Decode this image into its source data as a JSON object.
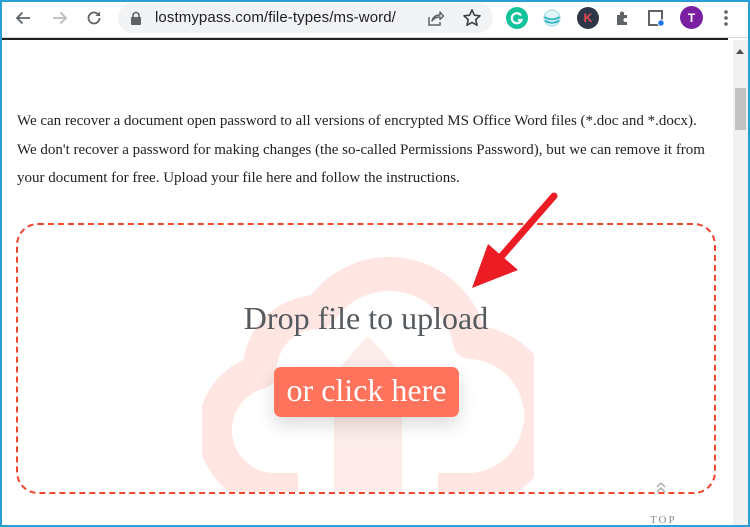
{
  "browser": {
    "url": "lostmypass.com/file-types/ms-word/",
    "nav": {
      "back_icon": "arrow-left-icon",
      "forward_icon": "arrow-right-icon",
      "reload_icon": "reload-icon"
    },
    "omnibox_icons": [
      "lock-icon",
      "share-icon",
      "star-icon"
    ],
    "extensions": [
      {
        "name": "grammarly",
        "letter": "G",
        "color": "#15c39a"
      },
      {
        "name": "globe-extension",
        "letter": "",
        "color": "#4fc1d6"
      },
      {
        "name": "k-extension",
        "letter": "K",
        "color": "#2d3748"
      },
      {
        "name": "extensions-puzzle",
        "letter": "",
        "color": "#5f6368"
      },
      {
        "name": "reading-mode",
        "letter": "",
        "color": "#1a73e8"
      }
    ],
    "profile": {
      "letter": "T",
      "color": "#7b1fa2"
    },
    "menu_icon": "kebab-menu-icon"
  },
  "page": {
    "intro_lines": [
      "We can recover a document open password to all versions of encrypted MS Office Word files (*.doc and *.docx).",
      "We don't recover a password for making changes (the so-called Permissions Password), but we can remove it from",
      "your document for free. Upload your file here and follow the instructions."
    ],
    "dropzone": {
      "title": "Drop file to upload",
      "button_label": "or click here",
      "accent_color": "#f0472e",
      "button_color": "#ff735c"
    },
    "back_to_top": {
      "label": "TOP"
    }
  }
}
